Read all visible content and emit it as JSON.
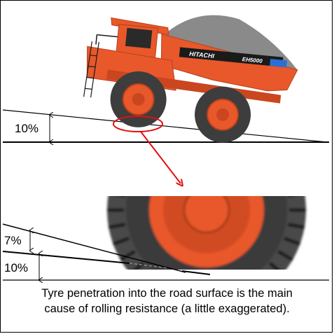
{
  "top_grade_label": "10%",
  "bottom_grade_small_label": "7%",
  "bottom_grade_large_label": "10%",
  "truck_brand": "HITACHI",
  "truck_model": "EH5000",
  "caption_line1": "Tyre penetration into the road surface is the main",
  "caption_line2": "cause of rolling resistance (a little exaggerated).",
  "colors": {
    "truck_body": "#e8582a",
    "truck_dark": "#b8401c",
    "tyre": "#3d3d3d",
    "load": "#8a8a8a",
    "arrow": "#e01010"
  }
}
